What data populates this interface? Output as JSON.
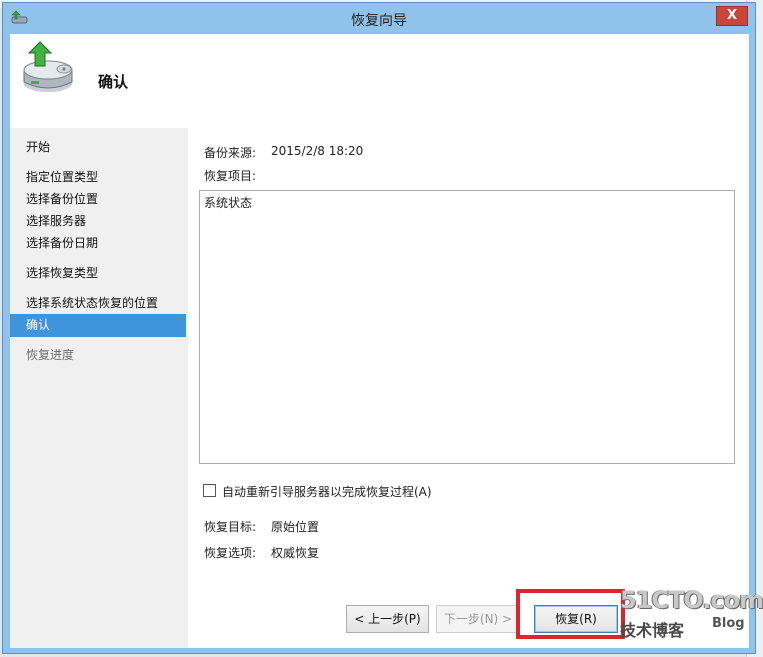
{
  "window": {
    "title": "恢复向导",
    "close_glyph": "X"
  },
  "header": {
    "title": "确认"
  },
  "sidebar": {
    "items": [
      {
        "label": "开始",
        "state": "normal"
      },
      {
        "label": "指定位置类型",
        "state": "normal"
      },
      {
        "label": "选择备份位置",
        "state": "normal"
      },
      {
        "label": "选择服务器",
        "state": "normal"
      },
      {
        "label": "选择备份日期",
        "state": "normal"
      },
      {
        "label": "选择恢复类型",
        "state": "normal"
      },
      {
        "label": "选择系统状态恢复的位置",
        "state": "normal"
      },
      {
        "label": "确认",
        "state": "active"
      },
      {
        "label": "恢复进度",
        "state": "disabled"
      }
    ]
  },
  "content": {
    "backup_source_label": "备份来源:",
    "backup_source_value": "2015/2/8 18:20",
    "recovery_items_label": "恢复项目:",
    "recovery_items": [
      "系统状态"
    ],
    "restart_checkbox_label": "自动重新引导服务器以完成恢复过程(A)",
    "restart_checkbox_checked": false,
    "recovery_target_label": "恢复目标:",
    "recovery_target_value": "原始位置",
    "recovery_option_label": "恢复选项:",
    "recovery_option_value": "权威恢复"
  },
  "buttons": {
    "back": "< 上一步(P)",
    "next": "下一步(N) >",
    "recover": "恢复(R)"
  },
  "watermark": {
    "site": "51CTO.com",
    "sub": "技术博客",
    "blog": "Blog"
  },
  "colors": {
    "accent": "#3f95dd",
    "title_bar": "#8fc3ec",
    "close": "#c7473d",
    "highlight": "#e0232e"
  }
}
